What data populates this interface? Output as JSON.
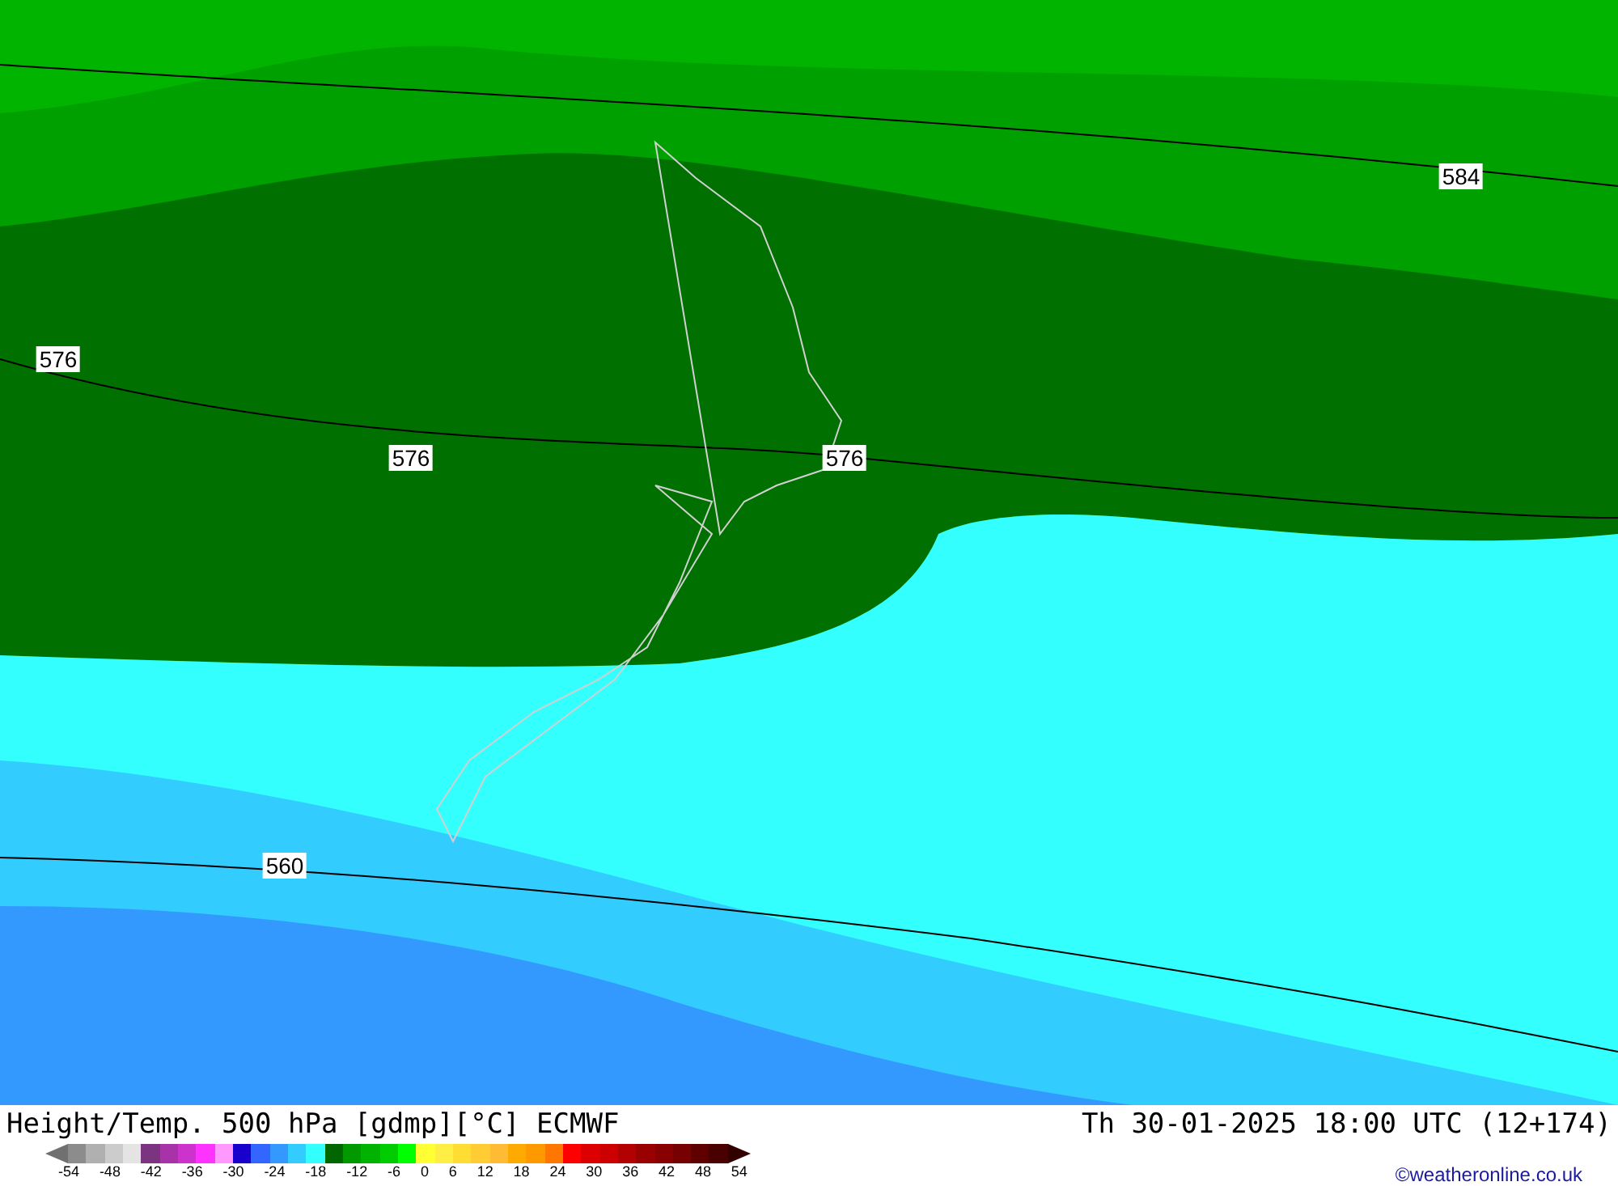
{
  "map": {
    "height_labels": [
      "584",
      "576",
      "576",
      "576",
      "560"
    ]
  },
  "footer": {
    "title": "Height/Temp. 500 hPa [gdmp][°C] ECMWF",
    "datetime": "Th 30-01-2025 18:00 UTC (12+174)",
    "credit": "©weatheronline.co.uk"
  },
  "legend": {
    "swatches": [
      {
        "color": "#8c8c8c"
      },
      {
        "color": "#b0b0b0"
      },
      {
        "color": "#cccccc"
      },
      {
        "color": "#e4e4e4"
      },
      {
        "color": "#7a3480"
      },
      {
        "color": "#a832a8"
      },
      {
        "color": "#cc33cc"
      },
      {
        "color": "#ff33ff"
      },
      {
        "color": "#ff99ff"
      },
      {
        "color": "#1a00cc"
      },
      {
        "color": "#3366ff"
      },
      {
        "color": "#3399ff"
      },
      {
        "color": "#33ccff"
      },
      {
        "color": "#33ffff"
      },
      {
        "color": "#006600"
      },
      {
        "color": "#009900"
      },
      {
        "color": "#00b300"
      },
      {
        "color": "#00cc00"
      },
      {
        "color": "#00ff00"
      },
      {
        "color": "#ffff33"
      },
      {
        "color": "#ffee44"
      },
      {
        "color": "#ffdd33"
      },
      {
        "color": "#ffcc33"
      },
      {
        "color": "#ffbb33"
      },
      {
        "color": "#ffaa00"
      },
      {
        "color": "#ff9900"
      },
      {
        "color": "#ff7700"
      },
      {
        "color": "#ff0000"
      },
      {
        "color": "#dd0000"
      },
      {
        "color": "#cc0000"
      },
      {
        "color": "#b30000"
      },
      {
        "color": "#990000"
      },
      {
        "color": "#880000"
      },
      {
        "color": "#770000"
      },
      {
        "color": "#5e0000"
      },
      {
        "color": "#4a0000"
      }
    ],
    "ticks": [
      "-54",
      "-48",
      "-42",
      "-36",
      "-30",
      "-24",
      "-18",
      "-12",
      "-6",
      "0",
      "6",
      "12",
      "18",
      "24",
      "30",
      "36",
      "42",
      "48",
      "54"
    ]
  }
}
